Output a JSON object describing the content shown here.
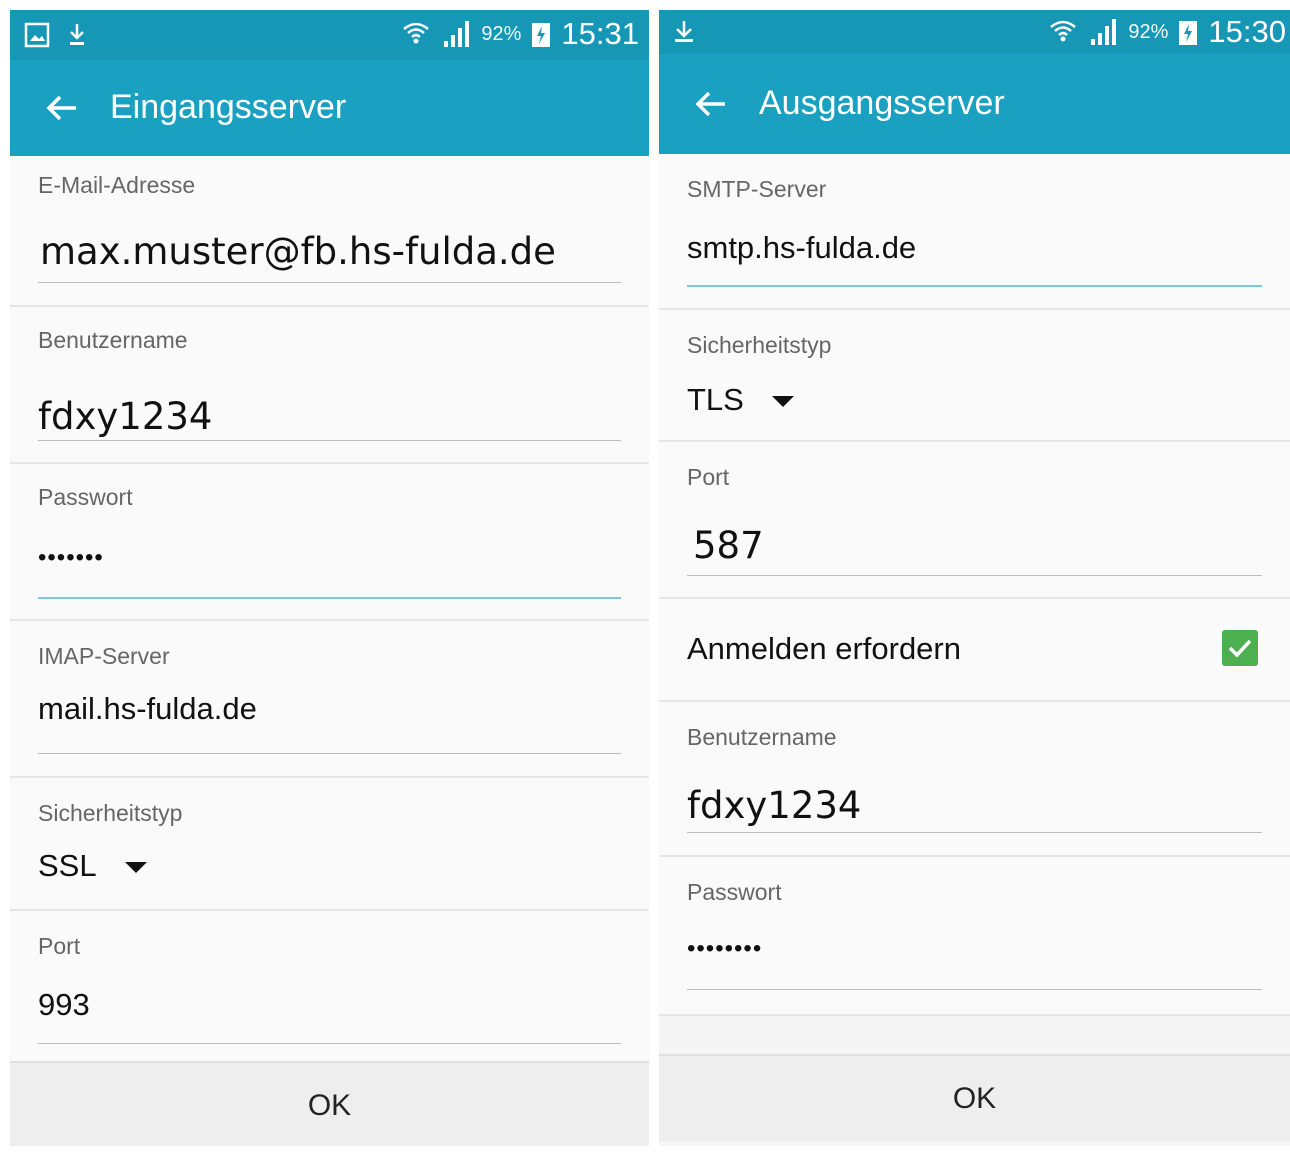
{
  "left": {
    "status": {
      "battery": "92%",
      "time": "15:31"
    },
    "title": "Eingangsserver",
    "fields": {
      "email": {
        "label": "E-Mail-Adresse",
        "value": "max.muster@fb.hs-fulda.de"
      },
      "username": {
        "label": "Benutzername",
        "value": "fdxy1234"
      },
      "password": {
        "label": "Passwort",
        "value": "•••••••"
      },
      "server": {
        "label": "IMAP-Server",
        "value": "mail.hs-fulda.de"
      },
      "security": {
        "label": "Sicherheitstyp",
        "value": "SSL"
      },
      "port": {
        "label": "Port",
        "value": "993"
      }
    },
    "ok_label": "OK"
  },
  "right": {
    "status": {
      "battery": "92%",
      "time": "15:30"
    },
    "title": "Ausgangsserver",
    "fields": {
      "server": {
        "label": "SMTP-Server",
        "value": "smtp.hs-fulda.de"
      },
      "security": {
        "label": "Sicherheitstyp",
        "value": "TLS"
      },
      "port": {
        "label": "Port",
        "value": "587"
      },
      "auth": {
        "label": "Anmelden erfordern",
        "checked": true
      },
      "username": {
        "label": "Benutzername",
        "value": "fdxy1234"
      },
      "password": {
        "label": "Passwort",
        "value": "••••••••"
      }
    },
    "ok_label": "OK"
  },
  "colors": {
    "statusbar": "#1597b5",
    "appbar": "#1aa0c0",
    "checkbox": "#4caf50",
    "active_underline": "#7cc9dc"
  }
}
